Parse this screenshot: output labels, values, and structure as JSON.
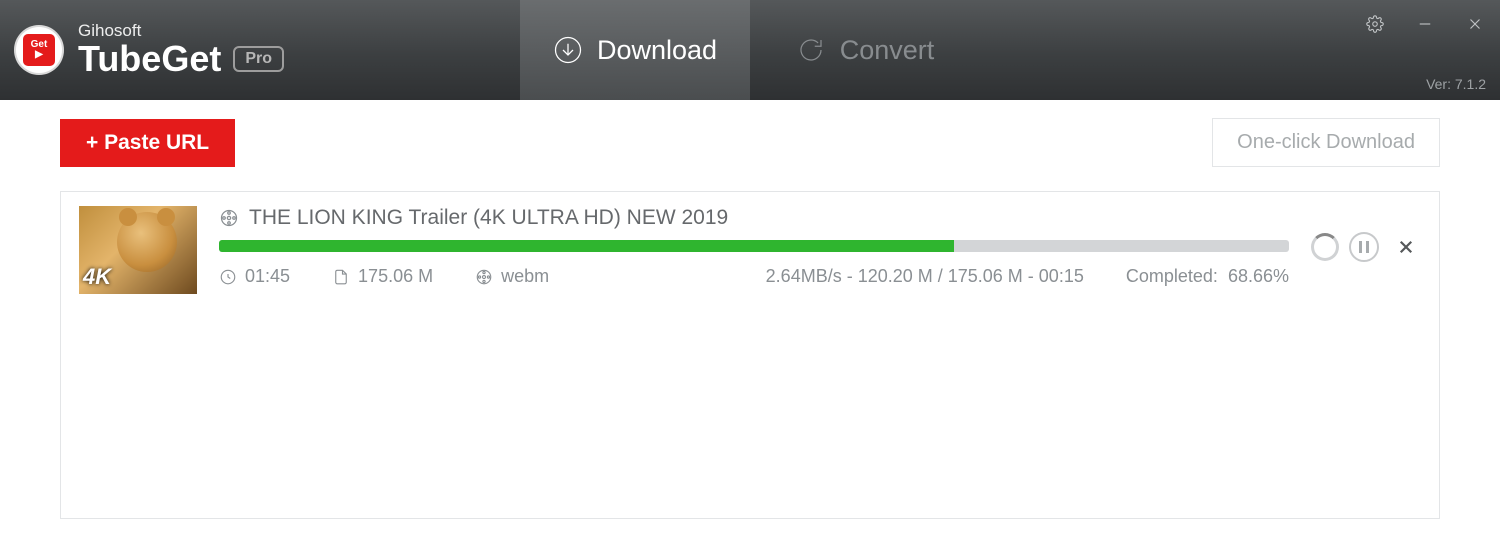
{
  "header": {
    "vendor": "Gihosoft",
    "app_name": "TubeGet",
    "badge": "Pro",
    "tabs": {
      "download": "Download",
      "convert": "Convert"
    },
    "version": "Ver: 7.1.2"
  },
  "actions": {
    "paste_url": "+ Paste URL",
    "one_click": "One-click Download"
  },
  "download": {
    "title": "THE LION KING Trailer (4K ULTRA HD) NEW 2019",
    "thumb_badge": "4K",
    "duration": "01:45",
    "size": "175.06 M",
    "format": "webm",
    "stats": "2.64MB/s - 120.20 M / 175.06 M - 00:15",
    "completed_label": "Completed:",
    "completed_pct": "68.66%",
    "progress_percent": 68.66
  }
}
